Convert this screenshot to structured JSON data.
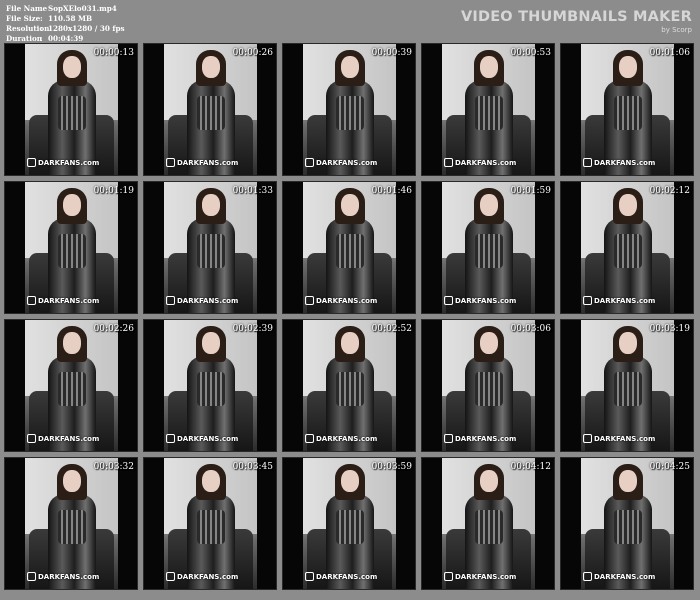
{
  "file_info": [
    {
      "label": "File Name",
      "value": "SopXElo031.mp4"
    },
    {
      "label": "File Size",
      "value": "110.58 MB"
    },
    {
      "label": "Resolution",
      "value": "1280x1280 / 30 fps"
    },
    {
      "label": "Duration",
      "value": "00:04:39"
    }
  ],
  "separator": ":",
  "brand": {
    "title": "VIDEO THUMBNAILS MAKER",
    "subtitle": "by Scorp"
  },
  "watermark": "DARKFANS.com",
  "thumbnails": [
    {
      "timestamp": "00:00:13"
    },
    {
      "timestamp": "00:00:26"
    },
    {
      "timestamp": "00:00:39"
    },
    {
      "timestamp": "00:00:53"
    },
    {
      "timestamp": "00:01:06"
    },
    {
      "timestamp": "00:01:19"
    },
    {
      "timestamp": "00:01:33"
    },
    {
      "timestamp": "00:01:46"
    },
    {
      "timestamp": "00:01:59"
    },
    {
      "timestamp": "00:02:12"
    },
    {
      "timestamp": "00:02:26"
    },
    {
      "timestamp": "00:02:39"
    },
    {
      "timestamp": "00:02:52"
    },
    {
      "timestamp": "00:03:06"
    },
    {
      "timestamp": "00:03:19"
    },
    {
      "timestamp": "00:03:32"
    },
    {
      "timestamp": "00:03:45"
    },
    {
      "timestamp": "00:03:59"
    },
    {
      "timestamp": "00:04:12"
    },
    {
      "timestamp": "00:04:25"
    }
  ]
}
